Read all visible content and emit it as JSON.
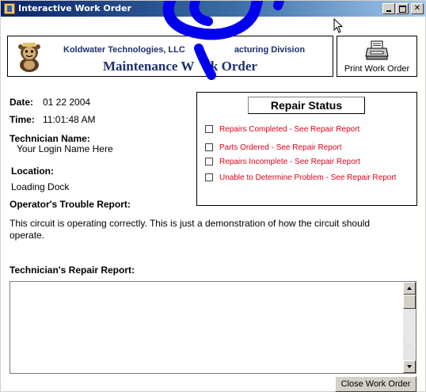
{
  "window": {
    "title": "Interactive Work Order"
  },
  "header": {
    "company": "Koldwater Technologies, LLC",
    "division": "Manufacturing Division",
    "company_visible": "Koldwater Technologies, LLC",
    "division_visible": "acturing Division",
    "doc_title": "Maintenance Work Order",
    "doc_title_part1": "Maintenance W",
    "doc_title_part2": "rk Order",
    "print_label": "Print Work Order"
  },
  "info": {
    "date_label": "Date:",
    "date_value": "01 22 2004",
    "time_label": "Time:",
    "time_value": "11:01:48 AM",
    "tech_label": "Technician Name:",
    "tech_value": "Your Login Name Here",
    "location_label": "Location:",
    "location_value": "Loading Dock"
  },
  "repair_status": {
    "title": "Repair Status",
    "items": [
      "Repairs Completed - See Repair Report",
      "Parts Ordered - See Repair Report",
      "Repairs Incomplete - See Repair Report",
      "Unable to Determine Problem - See Repair Report"
    ],
    "item_color": "#e0001a"
  },
  "trouble_report": {
    "label": "Operator's Trouble Report:",
    "text": "This circuit is operating correctly.  This is just a demonstration of how the circuit should operate."
  },
  "repair_report": {
    "label": "Technician's Repair Report:",
    "value": ""
  },
  "close_button": "Close Work Order",
  "colors": {
    "title_gradient_start": "#0a246a",
    "title_gradient_end": "#a6caf0",
    "header_text": "#1c2f6e",
    "pen_stroke": "#0000ee"
  }
}
